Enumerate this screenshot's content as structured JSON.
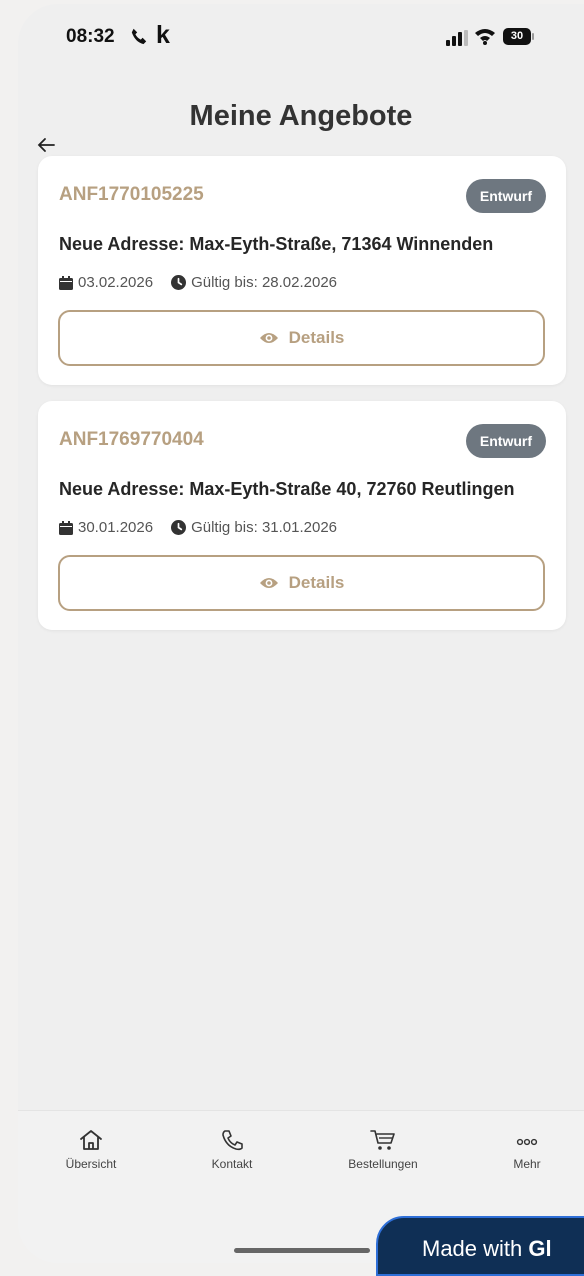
{
  "status_bar": {
    "time": "08:32",
    "k_label": "k",
    "battery": "30"
  },
  "header": {
    "title": "Meine Angebote"
  },
  "offers": [
    {
      "id": "ANF1770105225",
      "status": "Entwurf",
      "address": "Neue Adresse: Max-Eyth-Straße, 71364 Winnenden",
      "date": "03.02.2026",
      "valid_until": "Gültig bis: 28.02.2026",
      "details_label": "Details"
    },
    {
      "id": "ANF1769770404",
      "status": "Entwurf",
      "address": "Neue Adresse: Max-Eyth-Straße 40, 72760 Reutlingen",
      "date": "30.01.2026",
      "valid_until": "Gültig bis: 31.01.2026",
      "details_label": "Details"
    }
  ],
  "tab_bar": {
    "items": [
      {
        "label": "Übersicht",
        "icon": "home-icon"
      },
      {
        "label": "Kontakt",
        "icon": "phone-icon"
      },
      {
        "label": "Bestellungen",
        "icon": "cart-icon"
      },
      {
        "label": "Mehr",
        "icon": "more-icon"
      }
    ]
  },
  "badge_overlay": {
    "prefix": "Made with ",
    "brand": "Gl"
  },
  "colors": {
    "accent": "#b7a081",
    "badge": "#6e7780",
    "background": "#efefef"
  }
}
